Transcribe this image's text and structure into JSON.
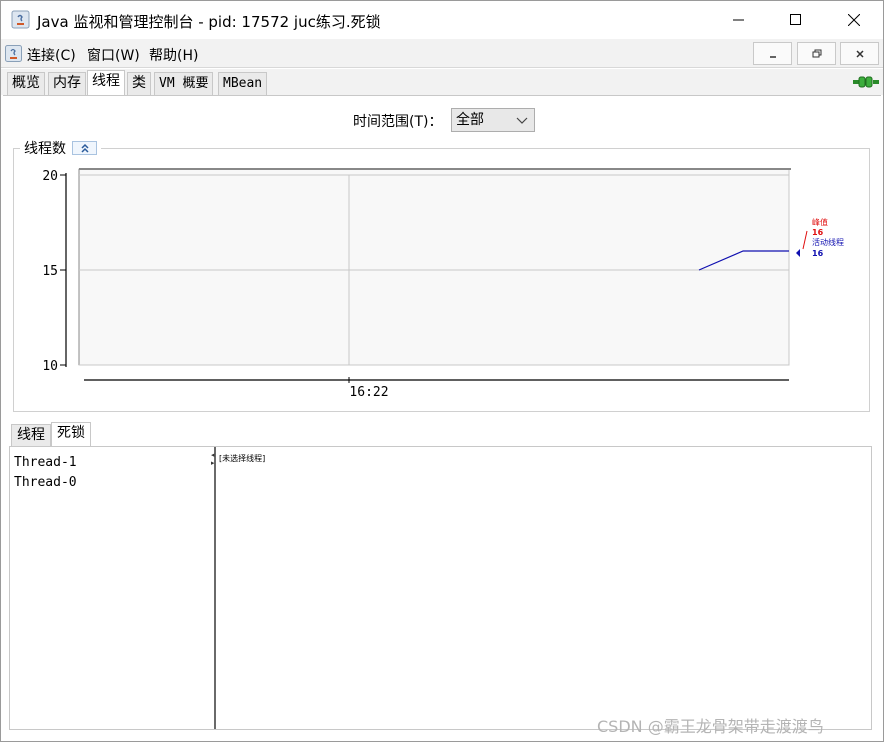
{
  "window": {
    "title": "Java 监视和管理控制台 - pid: 17572 juc练习.死锁"
  },
  "menubar": {
    "items": [
      {
        "label": "连接(C)"
      },
      {
        "label": "窗口(W)"
      },
      {
        "label": "帮助(H)"
      }
    ]
  },
  "tabs": [
    {
      "label": "概览"
    },
    {
      "label": "内存"
    },
    {
      "label": "线程"
    },
    {
      "label": "类"
    },
    {
      "label": "VM 概要"
    },
    {
      "label": "MBean"
    }
  ],
  "time_range": {
    "label": "时间范围(T)：",
    "selected": "全部"
  },
  "chart_panel": {
    "title": "线程数"
  },
  "chart_data": {
    "type": "line",
    "title": "",
    "xlabel": "",
    "ylabel": "",
    "ylim": [
      10,
      20
    ],
    "yticks": [
      "20",
      "15",
      "10"
    ],
    "xtick_label": "16:22",
    "grid": true,
    "legend_placement": "right",
    "series": [
      {
        "name": "峰值",
        "value": "16",
        "color": "#e01010"
      },
      {
        "name": "活动线程",
        "value": "16",
        "color": "#1010b0"
      }
    ],
    "line_points": [
      {
        "t": 0.0,
        "y": 15
      },
      {
        "t": 0.49,
        "y": 16
      },
      {
        "t": 1.0,
        "y": 16
      }
    ]
  },
  "subtabs": [
    {
      "label": "线程"
    },
    {
      "label": "死锁"
    }
  ],
  "threads": [
    {
      "name": "Thread-1"
    },
    {
      "name": "Thread-0"
    }
  ],
  "detail": {
    "placeholder": "[未选择线程]"
  },
  "watermark": "CSDN @霸王龙骨架带走渡渡鸟",
  "colors": {
    "peak": "#e01010",
    "live": "#1010b0",
    "chart_bg": "#f8f8f8"
  }
}
